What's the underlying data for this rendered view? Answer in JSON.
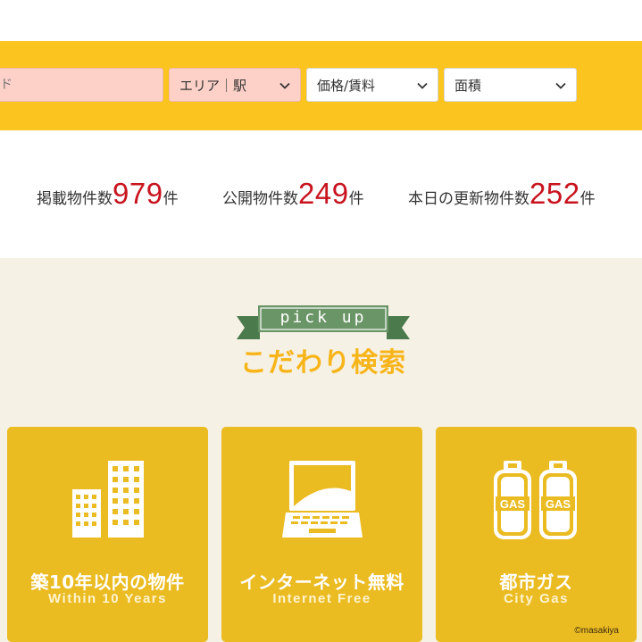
{
  "search": {
    "keyword_placeholder": "ド",
    "area_label": "エリア｜駅",
    "price_label": "価格/賃料",
    "size_label": "面積"
  },
  "stats": {
    "listed_label": "掲載物件数",
    "listed_count": "979",
    "public_label": "公開物件数",
    "public_count": "249",
    "updated_label": "本日の更新物件数",
    "updated_count": "252",
    "unit": "件"
  },
  "pickup": {
    "ribbon": "pick up",
    "title": "こだわり検索",
    "cards": [
      {
        "title": "築10年以内の物件",
        "subtitle": "Within 10 Years",
        "icon": "building-icon"
      },
      {
        "title": "インターネット無料",
        "subtitle": "Internet Free",
        "icon": "laptop-icon"
      },
      {
        "title": "都市ガス",
        "subtitle": "City Gas",
        "icon": "gas-cylinder-icon",
        "icon_text": "GAS",
        "credit": "©masakiya"
      }
    ]
  },
  "colors": {
    "brand_yellow": "#fbc41f",
    "card_yellow": "#ebbb22",
    "accent_red": "#c8141e",
    "ribbon_green": "#5e8a5d",
    "title_orange": "#f7b51a"
  }
}
